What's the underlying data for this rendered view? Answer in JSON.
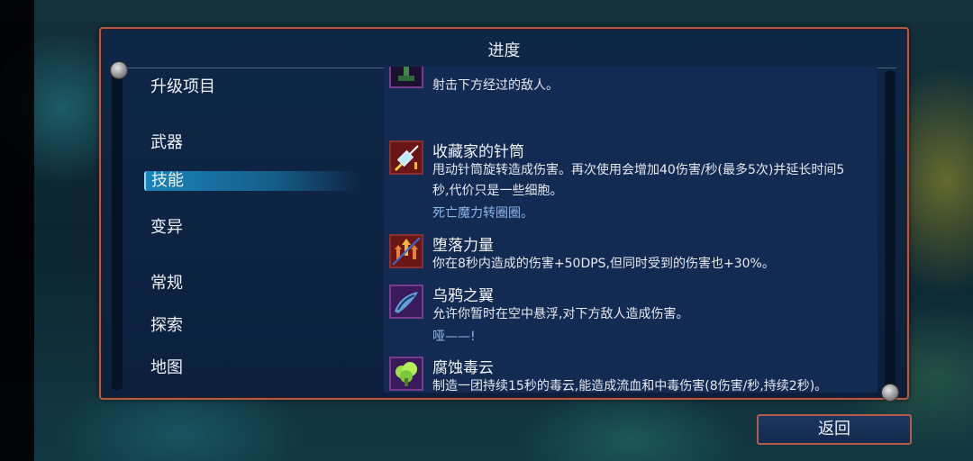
{
  "screen": {
    "title": "进度"
  },
  "nav": {
    "items": [
      {
        "label": "升级项目"
      },
      {
        "label": "武器"
      },
      {
        "label": "技能",
        "selected": true
      },
      {
        "label": "变异"
      },
      {
        "label": "常规"
      },
      {
        "label": "探索"
      },
      {
        "label": "地图"
      }
    ]
  },
  "items": [
    {
      "icon": "turret-icon",
      "name": "...",
      "desc": "射击下方经过的敌人。",
      "flavor": ""
    },
    {
      "icon": "syringe-icon",
      "name": "收藏家的针筒",
      "desc": "甩动针筒旋转造成伤害。再次使用会增加40伤害/秒(最多5次)并延长时间5秒,代价只是一些细胞。",
      "flavor": "死亡魔力转圈圈。"
    },
    {
      "icon": "arrows-up-icon",
      "name": "堕落力量",
      "desc": "你在8秒内造成的伤害+50DPS,但同时受到的伤害也+30%。",
      "flavor": ""
    },
    {
      "icon": "crow-wings-icon",
      "name": "乌鸦之翼",
      "desc": "允许你暂时在空中悬浮,对下方敌人造成伤害。",
      "flavor": "哑——!"
    },
    {
      "icon": "poison-cloud-icon",
      "name": "腐蚀毒云",
      "desc": "制造一团持续15秒的毒云,能造成流血和中毒伤害(8伤害/秒,持续2秒)。",
      "flavor": ""
    }
  ],
  "footer": {
    "back_label": "返回"
  },
  "colors": {
    "frame": "#b35a48",
    "panel": "#0f2747",
    "flavor_text": "#8fb6e8",
    "selection": "#1a84b8"
  }
}
